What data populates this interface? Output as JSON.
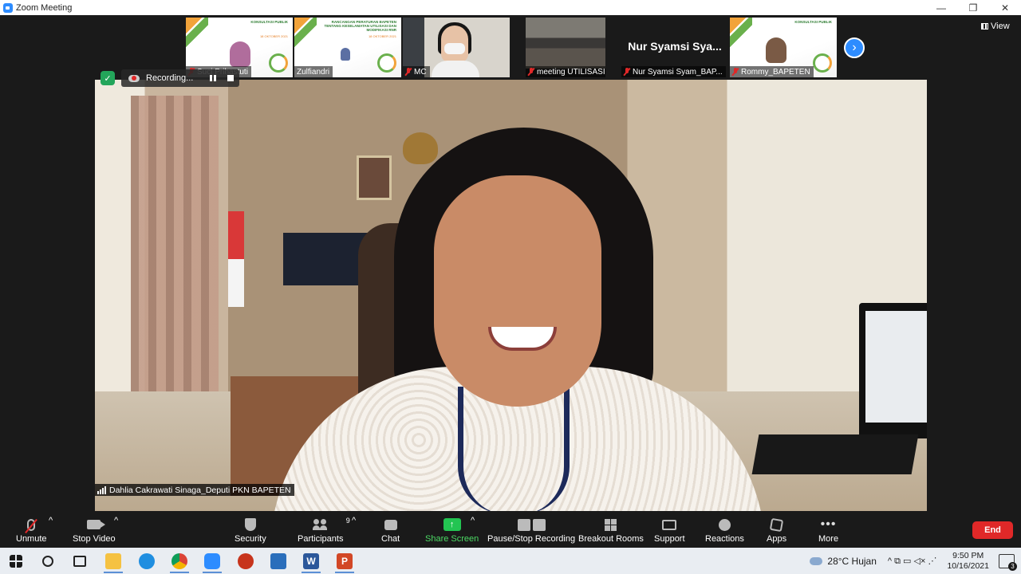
{
  "window": {
    "title": "Zoom Meeting",
    "controls": {
      "minimize": "—",
      "restore": "❐",
      "close": "✕"
    }
  },
  "thumbnails": [
    {
      "name": "Suci Prihastuti",
      "kind": "slide-with-face",
      "muted": true
    },
    {
      "name": "Zulfiandri",
      "kind": "slide",
      "muted": false
    },
    {
      "name": "MC",
      "kind": "video",
      "muted": true
    },
    {
      "name": "meeting UTILISASI",
      "kind": "room-video",
      "muted": true
    },
    {
      "name": "Nur Syamsi Syam_BAP...",
      "kind": "name-only",
      "display_name": "Nur Syamsi Sya...",
      "muted": true
    },
    {
      "name": "Rommy_BAPETEN",
      "kind": "slide-with-face",
      "muted": true
    }
  ],
  "slide_text": {
    "heading": "KONSULTASI PUBLIK",
    "body": "RANCANGAN PERATURAN BAPETEN TENTANG KESELAMATAN UTILISASI DAN MODIFIKASI RNR",
    "date": "18 OKTOBER 2021"
  },
  "view_button": "View",
  "next_icon": "›",
  "recording": {
    "label": "Recording..."
  },
  "security_badge_icon": "✓",
  "active_speaker": "Dahlia Cakrawati Sinaga_Deputi PKN BAPETEN",
  "toolbar": {
    "unmute": "Unmute",
    "stop_video": "Stop Video",
    "security": "Security",
    "participants": "Participants",
    "participants_count": "9",
    "chat": "Chat",
    "share_screen": "Share Screen",
    "share_icon": "↑",
    "pause_stop_recording": "Pause/Stop Recording",
    "breakout_rooms": "Breakout Rooms",
    "support": "Support",
    "reactions": "Reactions",
    "apps": "Apps",
    "more": "More",
    "more_icon": "•••",
    "end": "End",
    "caret": "^"
  },
  "taskbar": {
    "word_letter": "W",
    "ppt_letter": "P",
    "weather": "28°C  Hujan",
    "tray_icons": "^  ⧉  ▭  ◁×  ⋰",
    "time": "9:50 PM",
    "date": "10/16/2021",
    "notification_count": "3"
  },
  "colors": {
    "accent": "#2d8cff",
    "share_green": "#23c552",
    "end_red": "#e02828",
    "background": "#1a1a1a"
  }
}
